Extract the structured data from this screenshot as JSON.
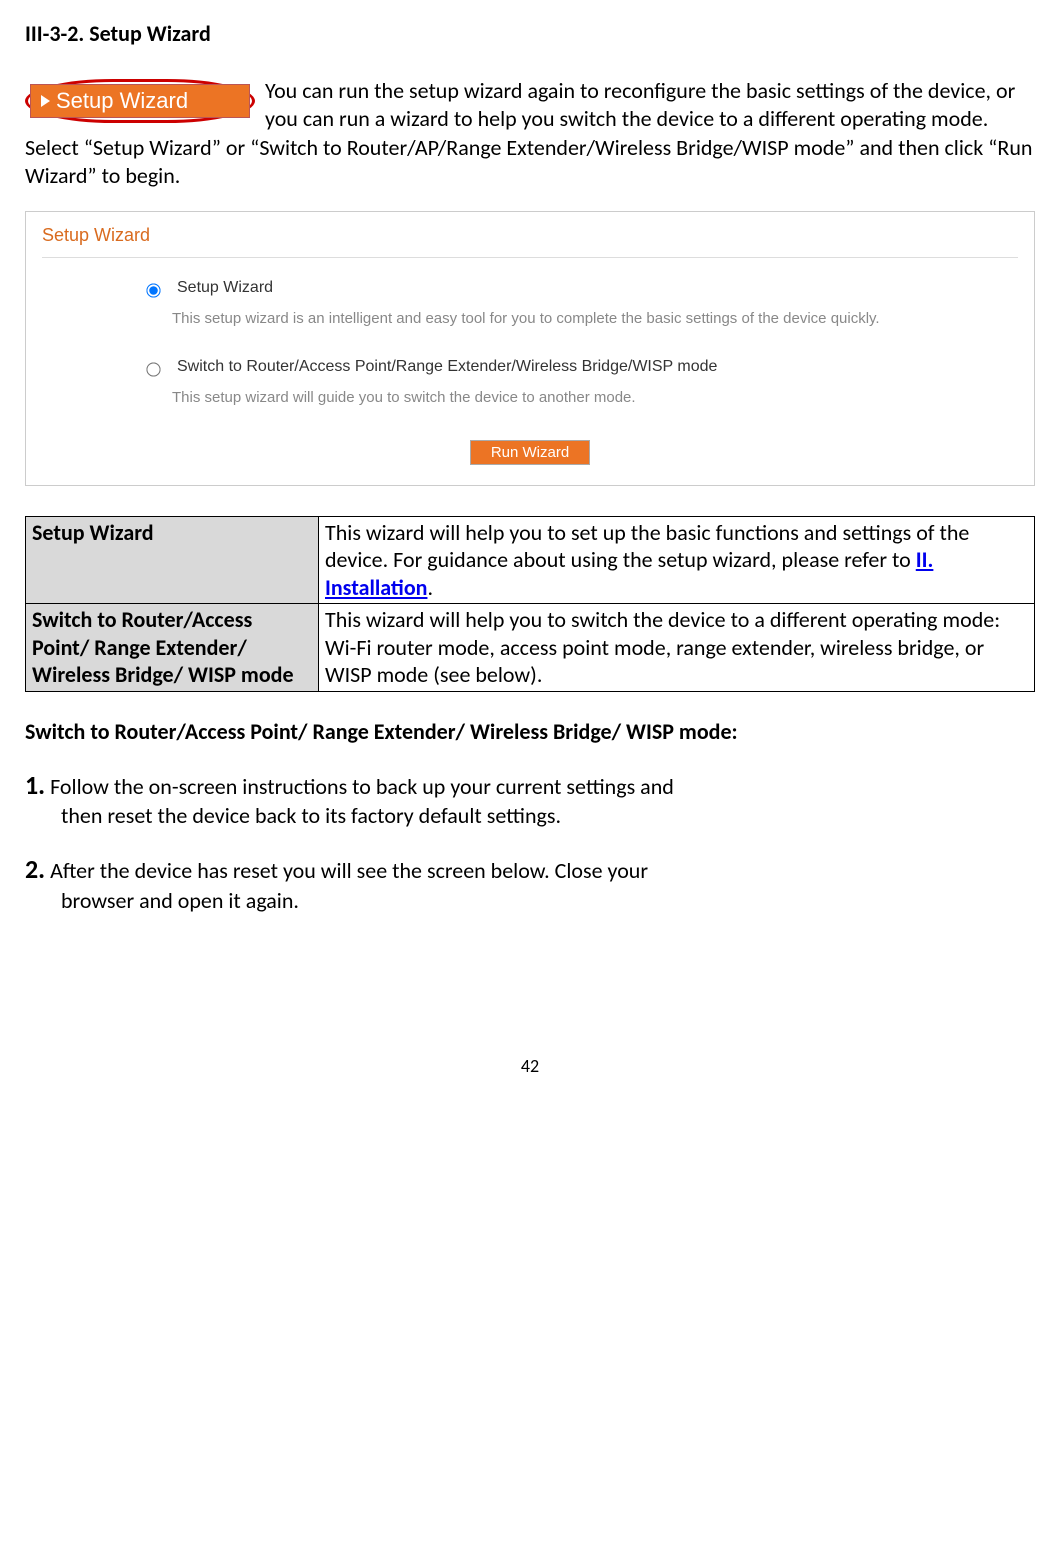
{
  "heading": "III-3-2. Setup Wizard",
  "navButtonLabel": "Setup Wizard",
  "introText": "You can run the setup wizard again to reconfigure the basic settings of the device, or you can run a wizard to help you switch the device to a different operating mode. Select “Setup Wizard” or “Switch to Router/AP/Range Extender/Wireless Bridge/WISP mode” and then click “Run Wizard” to begin.",
  "panel": {
    "title": "Setup Wizard",
    "option1": {
      "label": "Setup Wizard",
      "desc": "This setup wizard is an intelligent and easy tool for you to complete the basic settings of the device quickly."
    },
    "option2": {
      "label": "Switch to Router/Access Point/Range Extender/Wireless Bridge/WISP mode",
      "desc": "This setup wizard will guide you to switch the device to another mode."
    },
    "runWizard": "Run Wizard"
  },
  "table": {
    "row1": {
      "label": "Setup Wizard",
      "textA": "This wizard will help you to set up the basic functions and settings of the device. For guidance about using the setup wizard, please refer to ",
      "link": "II. Installation",
      "textB": "."
    },
    "row2": {
      "label": "Switch to Router/Access Point/ Range Extender/ Wireless Bridge/ WISP mode",
      "text": "This wizard will help you to switch the device to a different operating mode: Wi-Fi router mode, access point mode, range extender, wireless bridge, or WISP mode (see below)."
    }
  },
  "subHeading": "Switch to Router/Access Point/ Range Extender/ Wireless Bridge/ WISP mode:",
  "steps": {
    "s1num": "1.",
    "s1a": "Follow the on-screen instructions to back up your current settings and",
    "s1b": "then reset the device back to its factory default settings.",
    "s2num": "2.",
    "s2a": "After the device has reset you will see the screen below. Close your",
    "s2b": "browser and open it again."
  },
  "pageNumber": "42"
}
